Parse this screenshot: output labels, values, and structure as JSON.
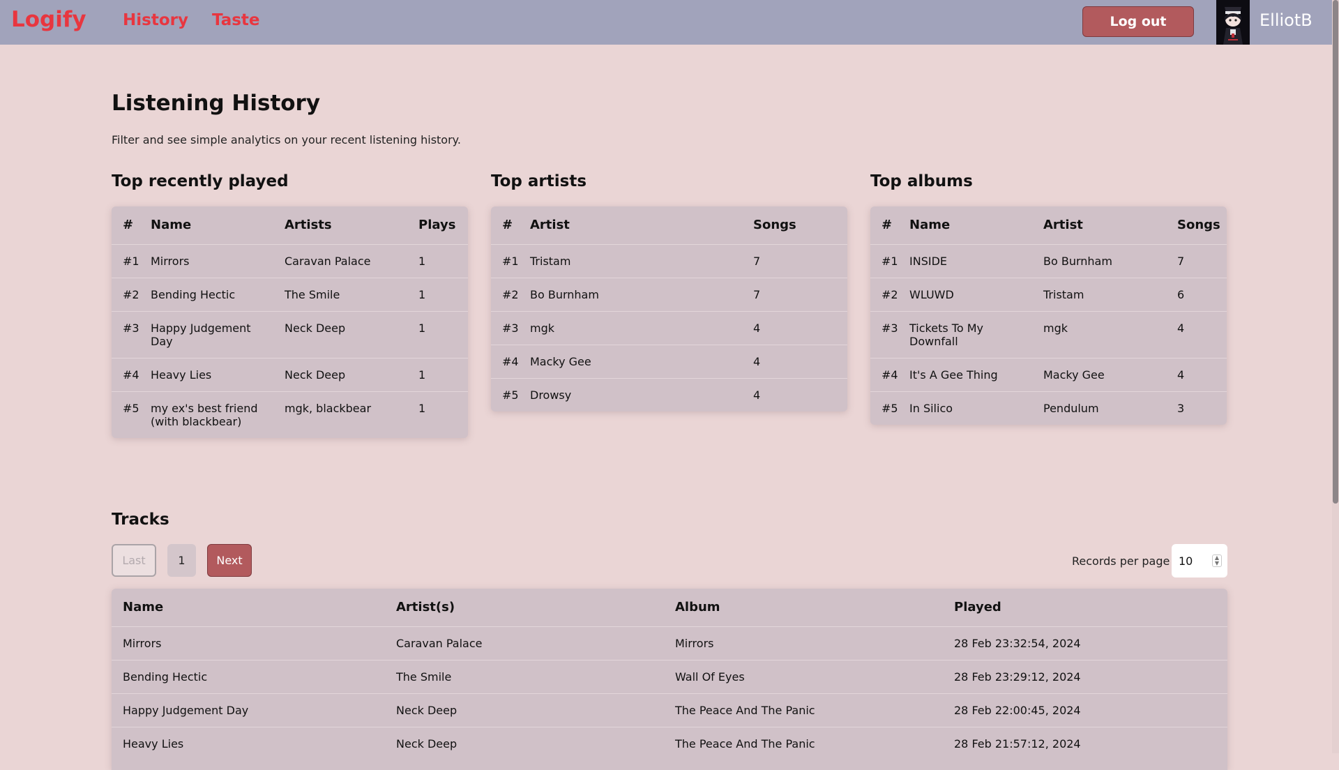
{
  "nav": {
    "brand": "Logify",
    "links": [
      "History",
      "Taste"
    ],
    "logout": "Log out",
    "username": "ElliotB",
    "avatar_icon": "anime-avatar-icon"
  },
  "colors": {
    "navbar": "#a1a3bb",
    "accent": "#e8363f",
    "button": "#b25a5d",
    "background": "#ead5d5",
    "card": "#d0c1c8"
  },
  "header": {
    "title": "Listening History",
    "subtitle": "Filter and see simple analytics on your recent listening history."
  },
  "top_played": {
    "title": "Top recently played",
    "columns": [
      "#",
      "Name",
      "Artists",
      "Plays"
    ],
    "rows": [
      {
        "rank": "#1",
        "name": "Mirrors",
        "artists": "Caravan Palace",
        "plays": "1"
      },
      {
        "rank": "#2",
        "name": "Bending Hectic",
        "artists": "The Smile",
        "plays": "1"
      },
      {
        "rank": "#3",
        "name": "Happy Judgement Day",
        "artists": "Neck Deep",
        "plays": "1"
      },
      {
        "rank": "#4",
        "name": "Heavy Lies",
        "artists": "Neck Deep",
        "plays": "1"
      },
      {
        "rank": "#5",
        "name": "my ex's best friend (with blackbear)",
        "artists": "mgk, blackbear",
        "plays": "1"
      }
    ]
  },
  "top_artists": {
    "title": "Top artists",
    "columns": [
      "#",
      "Artist",
      "Songs"
    ],
    "rows": [
      {
        "rank": "#1",
        "artist": "Tristam",
        "songs": "7"
      },
      {
        "rank": "#2",
        "artist": "Bo Burnham",
        "songs": "7"
      },
      {
        "rank": "#3",
        "artist": "mgk",
        "songs": "4"
      },
      {
        "rank": "#4",
        "artist": "Macky Gee",
        "songs": "4"
      },
      {
        "rank": "#5",
        "artist": "Drowsy",
        "songs": "4"
      }
    ]
  },
  "top_albums": {
    "title": "Top albums",
    "columns": [
      "#",
      "Name",
      "Artist",
      "Songs"
    ],
    "rows": [
      {
        "rank": "#1",
        "name": "INSIDE",
        "artist": "Bo Burnham",
        "songs": "7"
      },
      {
        "rank": "#2",
        "name": "WLUWD",
        "artist": "Tristam",
        "songs": "6"
      },
      {
        "rank": "#3",
        "name": "Tickets To My Downfall",
        "artist": "mgk",
        "songs": "4"
      },
      {
        "rank": "#4",
        "name": "It's A Gee Thing",
        "artist": "Macky Gee",
        "songs": "4"
      },
      {
        "rank": "#5",
        "name": "In Silico",
        "artist": "Pendulum",
        "songs": "3"
      }
    ]
  },
  "tracks": {
    "title": "Tracks",
    "pagination": {
      "last": "Last",
      "page": "1",
      "next": "Next"
    },
    "records_per_page_label": "Records per page",
    "records_per_page_value": "10",
    "columns": [
      "Name",
      "Artist(s)",
      "Album",
      "Played"
    ],
    "rows": [
      {
        "name": "Mirrors",
        "artists": "Caravan Palace",
        "album": "Mirrors",
        "played": "28 Feb 23:32:54, 2024"
      },
      {
        "name": "Bending Hectic",
        "artists": "The Smile",
        "album": "Wall Of Eyes",
        "played": "28 Feb 23:29:12, 2024"
      },
      {
        "name": "Happy Judgement Day",
        "artists": "Neck Deep",
        "album": "The Peace And The Panic",
        "played": "28 Feb 22:00:45, 2024"
      },
      {
        "name": "Heavy Lies",
        "artists": "Neck Deep",
        "album": "The Peace And The Panic",
        "played": "28 Feb 21:57:12, 2024"
      }
    ]
  }
}
